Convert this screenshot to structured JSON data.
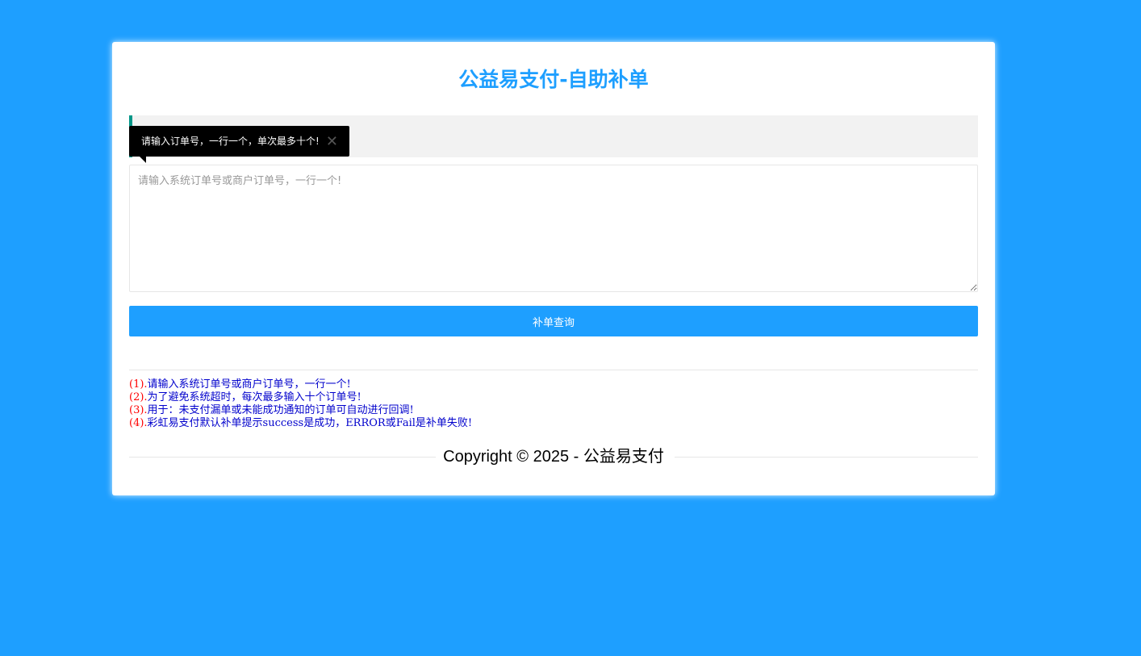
{
  "header": {
    "title": "公益易支付-自助补单"
  },
  "tooltip": {
    "text": "请输入订单号，一行一个，单次最多十个!",
    "close_glyph": "✕"
  },
  "form": {
    "textarea_placeholder": "请输入系统订单号或商户订单号，一行一个!",
    "textarea_value": "",
    "submit_label": "补单查询"
  },
  "tips": [
    {
      "num": "(1).",
      "text": "请输入系统订单号或商户订单号，一行一个!"
    },
    {
      "num": "(2).",
      "text": "为了避免系统超时，每次最多输入十个订单号!"
    },
    {
      "num": "(3).",
      "text": "用于：未支付漏单或未能成功通知的订单可自动进行回调!"
    },
    {
      "num": "(4).",
      "text": "彩虹易支付默认补单提示success是成功，ERROR或Fail是补单失败!"
    }
  ],
  "footer": {
    "copyright": "Copyright © 2025 - 公益易支付"
  },
  "colors": {
    "background": "#1e9fff",
    "accent": "#1e9fff",
    "notice_border": "#009688",
    "tip_number": "#ff0000",
    "tip_text": "#0000cc"
  }
}
